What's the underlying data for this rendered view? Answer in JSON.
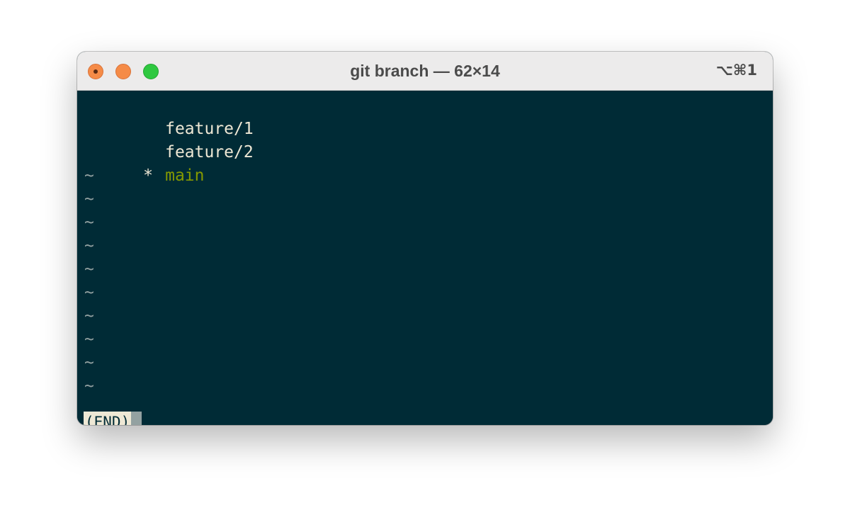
{
  "window": {
    "title": "git branch — 62×14",
    "shortcut": "⌥⌘1"
  },
  "terminal": {
    "branches": [
      {
        "marker": "",
        "name": "feature/1",
        "current": false
      },
      {
        "marker": "",
        "name": "feature/2",
        "current": false
      },
      {
        "marker": "*",
        "name": "main",
        "current": true
      }
    ],
    "filler": "~",
    "status": "(END)"
  },
  "colors": {
    "background": "#002b36",
    "foreground": "#eee8d5",
    "current_branch": "#859900",
    "close": "#f58b47",
    "minimize": "#f58b47",
    "zoom": "#2fc840"
  },
  "icons": {
    "close": "close-icon",
    "minimize": "minimize-icon",
    "zoom": "zoom-icon"
  }
}
